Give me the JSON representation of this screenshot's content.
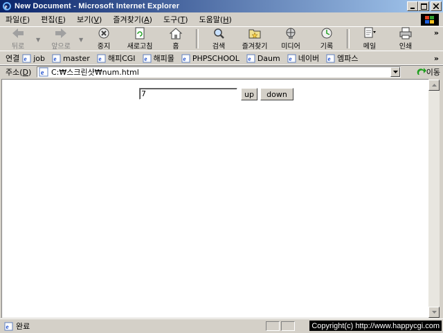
{
  "window": {
    "title": "New Document - Microsoft Internet Explorer",
    "buttons": {
      "minimize": "_",
      "maximize": "□",
      "close": "×"
    }
  },
  "menu": [
    {
      "label": "파일(",
      "key": "F",
      "end": ")"
    },
    {
      "label": "편집(",
      "key": "E",
      "end": ")"
    },
    {
      "label": "보기(",
      "key": "V",
      "end": ")"
    },
    {
      "label": "즐겨찾기(",
      "key": "A",
      "end": ")"
    },
    {
      "label": "도구(",
      "key": "T",
      "end": ")"
    },
    {
      "label": "도움말(",
      "key": "H",
      "end": ")"
    }
  ],
  "toolbar": {
    "back": "뒤로",
    "forward": "앞으로",
    "stop": "중지",
    "refresh": "새로고침",
    "home": "홈",
    "search": "검색",
    "favorites": "즐겨찾기",
    "media": "미디어",
    "history": "기록",
    "mail": "메일",
    "print": "인쇄"
  },
  "links": {
    "label": "연결",
    "items": [
      "job",
      "master",
      "해피CGI",
      "해피몰",
      "PHPSCHOOL",
      "Daum",
      "네이버",
      "엠파스"
    ]
  },
  "address": {
    "label": "주소(",
    "key": "D",
    "end": ")",
    "url": "C:₩스크린샷₩num.html",
    "go": "이동"
  },
  "page": {
    "input_value": "7",
    "up_label": "up",
    "down_label": "down"
  },
  "status": {
    "text": "완료",
    "copyright": "Copyright(c) http://www.happycgi.com"
  },
  "colors": {
    "title_start": "#0a246a",
    "title_end": "#a6caf0",
    "face": "#d4d0c8"
  }
}
